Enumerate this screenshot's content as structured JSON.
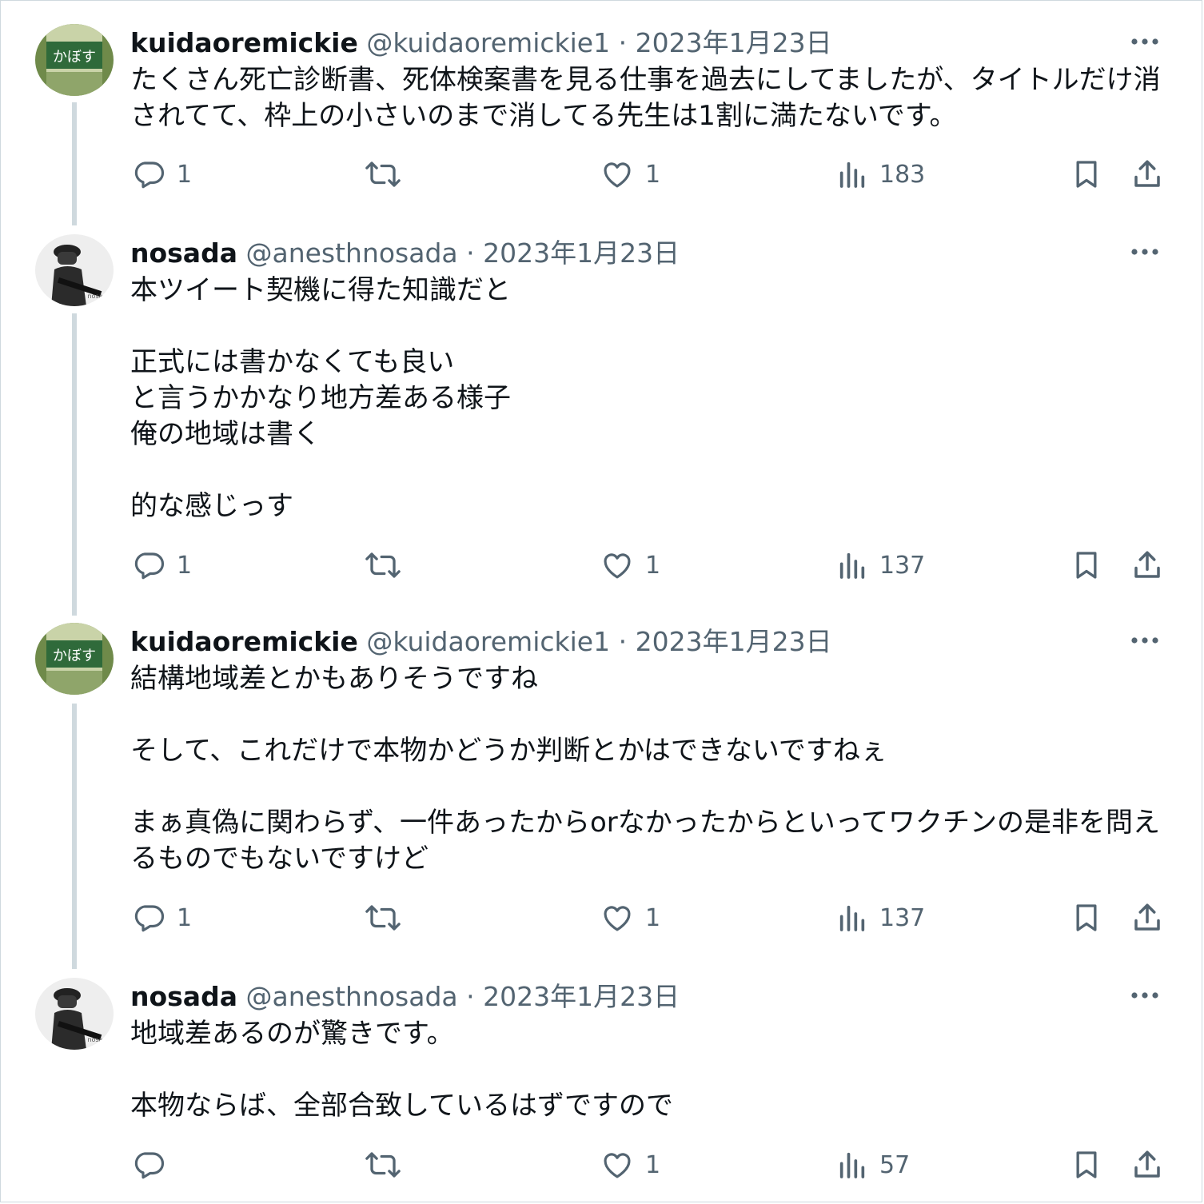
{
  "tweets": [
    {
      "name": "kuidaoremickie",
      "handle": "@kuidaoremickie1",
      "date": "2023年1月23日",
      "text": "たくさん死亡診断書、死体検案書を見る仕事を過去にしてましたが、タイトルだけ消されてて、枠上の小さいのまで消してる先生は1割に満たないです。",
      "replies": "1",
      "retweets": "",
      "likes": "1",
      "views": "183",
      "avatar_text": "かぼす"
    },
    {
      "name": "nosada",
      "handle": "@anesthnosada",
      "date": "2023年1月23日",
      "text": "本ツイート契機に得た知識だと\n\n正式には書かなくても良い\nと言うかかなり地方差ある様子\n俺の地域は書く\n\n的な感じっす",
      "replies": "1",
      "retweets": "",
      "likes": "1",
      "views": "137",
      "avatar_text": "nosada"
    },
    {
      "name": "kuidaoremickie",
      "handle": "@kuidaoremickie1",
      "date": "2023年1月23日",
      "text": "結構地域差とかもありそうですね\n\nそして、これだけで本物かどうか判断とかはできないですねぇ\n\nまぁ真偽に関わらず、一件あったからorなかったからといってワクチンの是非を問えるものでもないですけど",
      "replies": "1",
      "retweets": "",
      "likes": "1",
      "views": "137",
      "avatar_text": "かぼす"
    },
    {
      "name": "nosada",
      "handle": "@anesthnosada",
      "date": "2023年1月23日",
      "text": "地域差あるのが驚きです。\n\n本物ならば、全部合致しているはずですので",
      "replies": "",
      "retweets": "",
      "likes": "1",
      "views": "57",
      "avatar_text": "nosada"
    }
  ],
  "icons": {
    "reply": "reply-icon",
    "retweet": "retweet-icon",
    "like": "heart-icon",
    "views": "views-icon",
    "bookmark": "bookmark-icon",
    "share": "share-icon",
    "more": "more-icon"
  },
  "colors": {
    "text": "#0f1419",
    "secondary": "#536471",
    "thread_line": "#cfd9de"
  }
}
